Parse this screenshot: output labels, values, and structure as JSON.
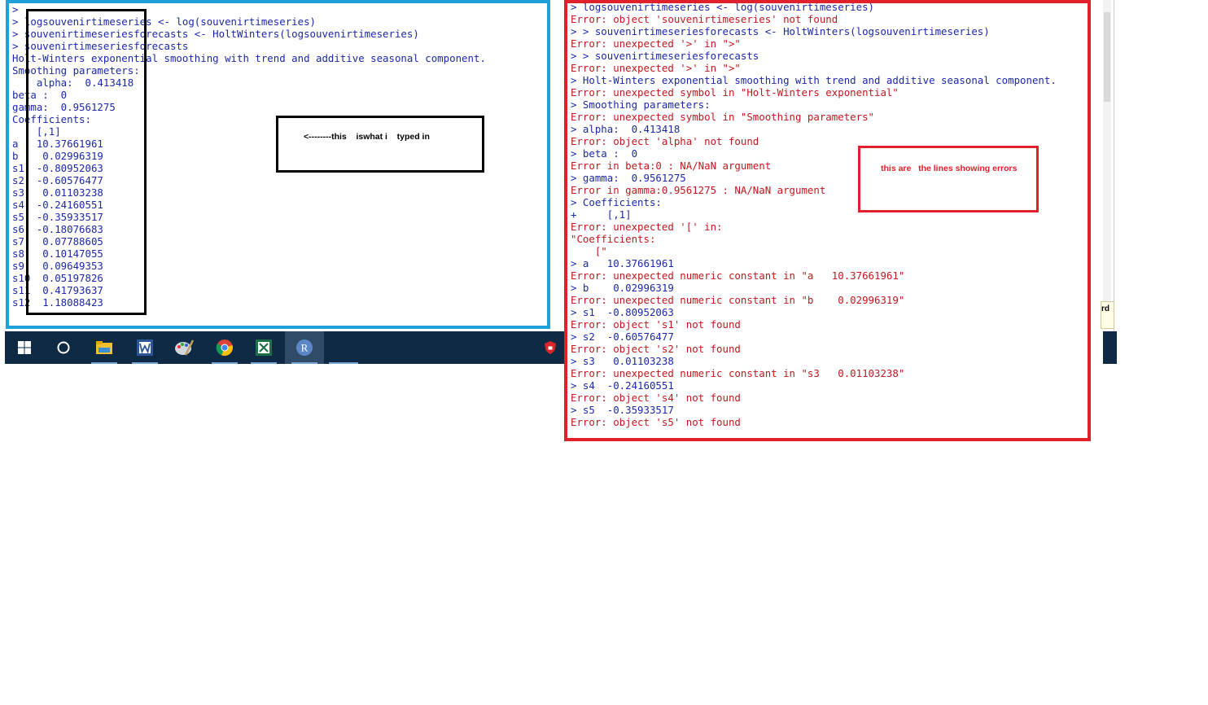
{
  "left_console": {
    "lines": [
      {
        "text": ">",
        "kind": "cmd"
      },
      {
        "text": "> logsouvenirtimeseries <- log(souvenirtimeseries)",
        "kind": "cmd"
      },
      {
        "text": "> souvenirtimeseriesforecasts <- HoltWinters(logsouvenirtimeseries)",
        "kind": "cmd"
      },
      {
        "text": "> souvenirtimeseriesforecasts",
        "kind": "cmd"
      },
      {
        "text": "Holt-Winters exponential smoothing with trend and additive seasonal component.",
        "kind": "out"
      },
      {
        "text": "Smoothing parameters:",
        "kind": "out"
      },
      {
        "text": "    alpha:  0.413418",
        "kind": "out"
      },
      {
        "text": "beta :  0",
        "kind": "out"
      },
      {
        "text": "gamma:  0.9561275",
        "kind": "out"
      },
      {
        "text": "Coefficients:",
        "kind": "out"
      },
      {
        "text": "    [,1]",
        "kind": "out"
      },
      {
        "text": "a   10.37661961",
        "kind": "out"
      },
      {
        "text": "b    0.02996319",
        "kind": "out"
      },
      {
        "text": "s1  -0.80952063",
        "kind": "out"
      },
      {
        "text": "s2  -0.60576477",
        "kind": "out"
      },
      {
        "text": "s3   0.01103238",
        "kind": "out"
      },
      {
        "text": "s4  -0.24160551",
        "kind": "out"
      },
      {
        "text": "s5  -0.35933517",
        "kind": "out"
      },
      {
        "text": "s6  -0.18076683",
        "kind": "out"
      },
      {
        "text": "s7   0.07788605",
        "kind": "out"
      },
      {
        "text": "s8   0.10147055",
        "kind": "out"
      },
      {
        "text": "s9   0.09649353",
        "kind": "out"
      },
      {
        "text": "s10  0.05197826",
        "kind": "out"
      },
      {
        "text": "s11  0.41793637",
        "kind": "out"
      },
      {
        "text": "s12  1.18088423",
        "kind": "out"
      }
    ]
  },
  "right_console": {
    "lines": [
      {
        "text": "> logsouvenirtimeseries <- log(souvenirtimeseries)",
        "kind": "cmd"
      },
      {
        "text": "Error: object 'souvenirtimeseries' not found",
        "kind": "err"
      },
      {
        "text": "> > souvenirtimeseriesforecasts <- HoltWinters(logsouvenirtimeseries)",
        "kind": "cmd"
      },
      {
        "text": "Error: unexpected '>' in \">\"",
        "kind": "err"
      },
      {
        "text": "> > souvenirtimeseriesforecasts",
        "kind": "cmd"
      },
      {
        "text": "Error: unexpected '>' in \">\"",
        "kind": "err"
      },
      {
        "text": "> Holt-Winters exponential smoothing with trend and additive seasonal component.",
        "kind": "cmd"
      },
      {
        "text": "Error: unexpected symbol in \"Holt-Winters exponential\"",
        "kind": "err"
      },
      {
        "text": "> Smoothing parameters:",
        "kind": "cmd"
      },
      {
        "text": "Error: unexpected symbol in \"Smoothing parameters\"",
        "kind": "err"
      },
      {
        "text": "> alpha:  0.413418",
        "kind": "cmd"
      },
      {
        "text": "Error: object 'alpha' not found",
        "kind": "err"
      },
      {
        "text": "> beta :  0",
        "kind": "cmd"
      },
      {
        "text": "Error in beta:0 : NA/NaN argument",
        "kind": "err"
      },
      {
        "text": "> gamma:  0.9561275",
        "kind": "cmd"
      },
      {
        "text": "Error in gamma:0.9561275 : NA/NaN argument",
        "kind": "err"
      },
      {
        "text": "> Coefficients:",
        "kind": "cmd"
      },
      {
        "text": "+     [,1]",
        "kind": "cmd"
      },
      {
        "text": "Error: unexpected '[' in:",
        "kind": "err"
      },
      {
        "text": "\"Coefficients:",
        "kind": "err"
      },
      {
        "text": "    [\"",
        "kind": "err"
      },
      {
        "text": "> a   10.37661961",
        "kind": "cmd"
      },
      {
        "text": "Error: unexpected numeric constant in \"a   10.37661961\"",
        "kind": "err"
      },
      {
        "text": "> b    0.02996319",
        "kind": "cmd"
      },
      {
        "text": "Error: unexpected numeric constant in \"b    0.02996319\"",
        "kind": "err"
      },
      {
        "text": "> s1  -0.80952063",
        "kind": "cmd"
      },
      {
        "text": "Error: object 's1' not found",
        "kind": "err"
      },
      {
        "text": "> s2  -0.60576477",
        "kind": "cmd"
      },
      {
        "text": "Error: object 's2' not found",
        "kind": "err"
      },
      {
        "text": "> s3   0.01103238",
        "kind": "cmd"
      },
      {
        "text": "Error: unexpected numeric constant in \"s3   0.01103238\"",
        "kind": "err"
      },
      {
        "text": "> s4  -0.24160551",
        "kind": "cmd"
      },
      {
        "text": "Error: object 's4' not found",
        "kind": "err"
      },
      {
        "text": "> s5  -0.35933517",
        "kind": "cmd"
      },
      {
        "text": "Error: object 's5' not found",
        "kind": "err"
      }
    ]
  },
  "annotations": {
    "typed_in": "<--------this    iswhat i    typed in",
    "errors_note": "this are   the lines showing errors"
  },
  "taskbar": {
    "items": [
      {
        "icon": "windows-start-icon",
        "label": "Start"
      },
      {
        "icon": "search-circle-icon",
        "label": "Search"
      },
      {
        "icon": "file-explorer-icon",
        "label": "File Explorer"
      },
      {
        "icon": "word-icon",
        "label": "Word"
      },
      {
        "icon": "paint-icon",
        "label": "Paint"
      },
      {
        "icon": "chrome-icon",
        "label": "Chrome"
      },
      {
        "icon": "excel-icon",
        "label": "Excel"
      },
      {
        "icon": "r-icon",
        "label": "R"
      }
    ]
  },
  "side_strip": {
    "label": "rd"
  },
  "colors": {
    "command_blue": "#1c28a8",
    "error_red": "#c0181e",
    "left_frame": "#1da1d8",
    "right_frame": "#e0202b",
    "taskbar": "#0f2a44"
  }
}
